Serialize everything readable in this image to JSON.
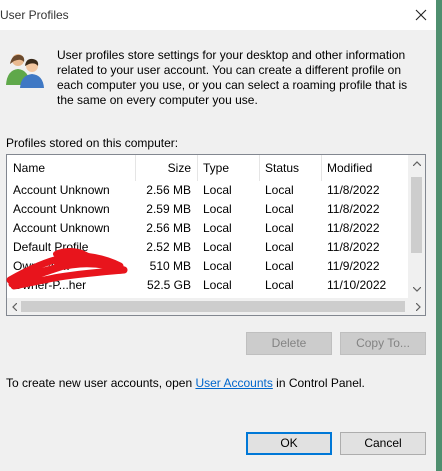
{
  "window": {
    "title": "User Profiles"
  },
  "intro_text": "User profiles store settings for your desktop and other information related to your user account. You can create a different profile on each computer you use, or you can select a roaming profile that is the same on every computer you use.",
  "profiles_label": "Profiles stored on this computer:",
  "columns": {
    "name": "Name",
    "size": "Size",
    "type": "Type",
    "status": "Status",
    "modified": "Modified"
  },
  "profiles": [
    {
      "name": "Account Unknown",
      "size": "2.56 MB",
      "type": "Local",
      "status": "Local",
      "modified": "11/8/2022"
    },
    {
      "name": "Account Unknown",
      "size": "2.59 MB",
      "type": "Local",
      "status": "Local",
      "modified": "11/8/2022"
    },
    {
      "name": "Account Unknown",
      "size": "2.56 MB",
      "type": "Local",
      "status": "Local",
      "modified": "11/8/2022"
    },
    {
      "name": "Default Profile",
      "size": "2.52 MB",
      "type": "Local",
      "status": "Local",
      "modified": "11/8/2022"
    },
    {
      "name": "Own...\\C...",
      "size": "510 MB",
      "type": "Local",
      "status": "Local",
      "modified": "11/9/2022"
    },
    {
      "name": "Owner-P...her",
      "size": "52.5 GB",
      "type": "Local",
      "status": "Local",
      "modified": "11/10/2022"
    }
  ],
  "buttons": {
    "delete": "Delete",
    "copy_to": "Copy To...",
    "ok": "OK",
    "cancel": "Cancel"
  },
  "footer": {
    "prefix": "To create new user accounts, open ",
    "link": "User Accounts",
    "suffix": " in Control Panel."
  },
  "icons": {
    "close": "close-icon",
    "users": "users-icon"
  },
  "colors": {
    "link": "#0066cc",
    "scribble": "#e8141c",
    "accent": "#0078d7"
  }
}
